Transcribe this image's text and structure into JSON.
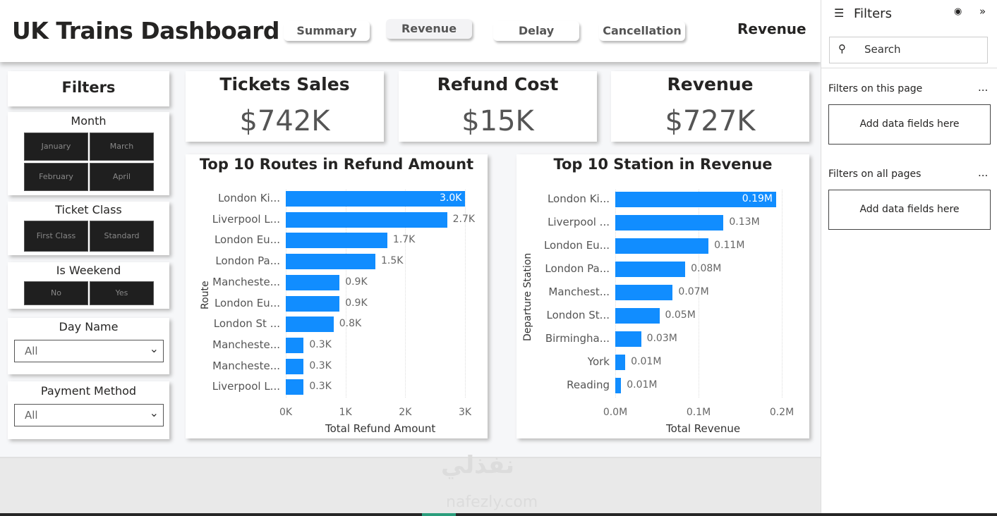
{
  "header": {
    "title": "UK Trains Dashboard",
    "nav": [
      "Summary",
      "Revenue",
      "Delay",
      "Cancellation"
    ],
    "active_nav": "Revenue",
    "page_label": "Revenue"
  },
  "filters_panel": {
    "title": "Filters",
    "month": {
      "label": "Month",
      "options": [
        "January",
        "March",
        "February",
        "April"
      ]
    },
    "ticket_class": {
      "label": "Ticket Class",
      "options": [
        "First Class",
        "Standard"
      ]
    },
    "is_weekend": {
      "label": "Is Weekend",
      "options": [
        "No",
        "Yes"
      ]
    },
    "day_name": {
      "label": "Day Name",
      "value": "All"
    },
    "payment_method": {
      "label": "Payment Method",
      "value": "All"
    }
  },
  "kpis": [
    {
      "title": "Tickets Sales",
      "value": "$742K"
    },
    {
      "title": "Refund Cost",
      "value": "$15K"
    },
    {
      "title": "Revenue",
      "value": "$727K"
    }
  ],
  "chart_data": [
    {
      "type": "bar",
      "orientation": "horizontal",
      "title": "Top 10 Routes in Refund Amount",
      "xlabel": "Total Refund Amount",
      "ylabel": "Route",
      "xlim": [
        0,
        3000
      ],
      "xticks": [
        "0K",
        "1K",
        "2K",
        "3K"
      ],
      "categories": [
        "London Ki...",
        "Liverpool L...",
        "London Eu...",
        "London Pa...",
        "Mancheste...",
        "London Eu...",
        "London St ...",
        "Mancheste...",
        "Mancheste...",
        "Liverpool L..."
      ],
      "values": [
        3000,
        2700,
        1700,
        1500,
        900,
        900,
        800,
        300,
        300,
        300
      ],
      "labels": [
        "3.0K",
        "2.7K",
        "1.7K",
        "1.5K",
        "0.9K",
        "0.9K",
        "0.8K",
        "0.3K",
        "0.3K",
        "0.3K"
      ],
      "color": "#118dff"
    },
    {
      "type": "bar",
      "orientation": "horizontal",
      "title": "Top 10 Station in Revenue",
      "xlabel": "Total Revenue",
      "ylabel": "Departure Station",
      "xlim": [
        0,
        0.2
      ],
      "xticks": [
        "0.0M",
        "0.1M",
        "0.2M"
      ],
      "categories": [
        "London Ki...",
        "Liverpool ...",
        "London Eu...",
        "London Pa...",
        "Manchest...",
        "London St...",
        "Birmingha...",
        "York",
        "Reading"
      ],
      "values": [
        0.193,
        0.13,
        0.112,
        0.084,
        0.069,
        0.053,
        0.031,
        0.012,
        0.007
      ],
      "labels": [
        "0.19M",
        "0.13M",
        "0.11M",
        "0.08M",
        "0.07M",
        "0.05M",
        "0.03M",
        "0.01M",
        "0.01M"
      ],
      "color": "#118dff"
    }
  ],
  "filter_pane": {
    "title": "Filters",
    "search_placeholder": "Search",
    "this_page": "Filters on this page",
    "all_pages": "Filters on all pages",
    "add_fields": "Add data fields here",
    "more": "..."
  },
  "watermark": {
    "arabic": "نفذلي",
    "latin": "nafezly.com"
  }
}
